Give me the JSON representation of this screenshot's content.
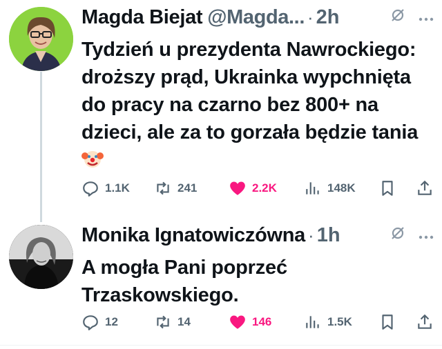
{
  "tweets": [
    {
      "author_name": "Magda Biejat",
      "handle": "@Magda...",
      "separator": "·",
      "time": "2h",
      "text": "Tydzień u prezydenta Nawrockiego: droższy prąd, Ukrainka wypchnięta do pracy na czarno bez 800+ na dzieci, ale za to gorzała będzie tania",
      "emoji_icon": "clown-face-icon",
      "replies": "1.1K",
      "retweets": "241",
      "likes": "2.2K",
      "views": "148K"
    },
    {
      "author_name": "Monika Ignatowiczówna",
      "separator": "·",
      "time": "1h",
      "text": "A mogła Pani poprzeć Trzaskowskiego.",
      "replies": "12",
      "retweets": "14",
      "likes": "146",
      "views": "1.5K"
    }
  ],
  "colors": {
    "like_active": "#f91880",
    "secondary_text": "#536471",
    "thread_line": "#cfd9de",
    "avatar1_bg": "#8cd33f"
  },
  "icons": [
    "reply-icon",
    "retweet-icon",
    "heart-icon",
    "views-icon",
    "bookmark-icon",
    "share-icon",
    "grok-icon",
    "more-icon"
  ]
}
